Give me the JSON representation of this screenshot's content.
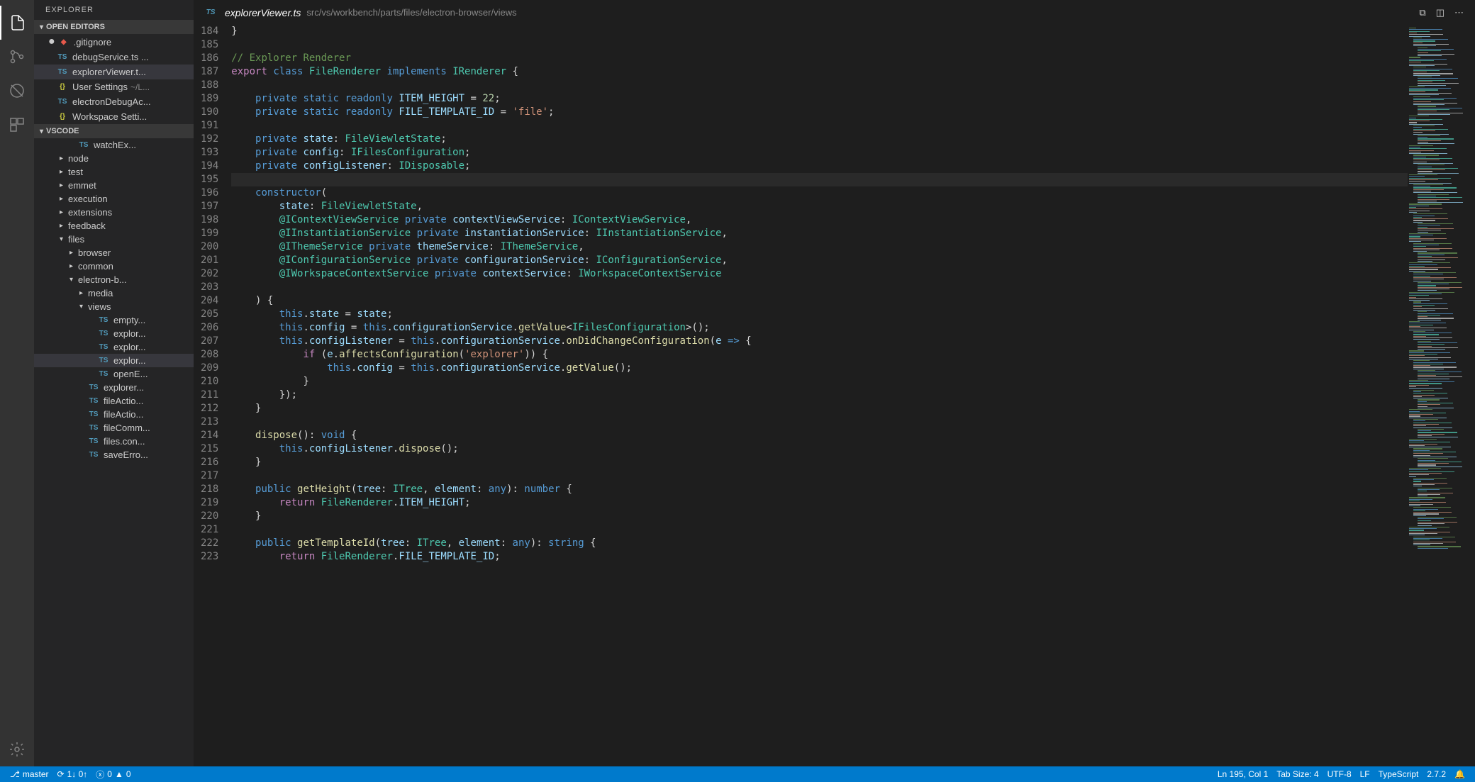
{
  "sidebar": {
    "title": "EXPLORER",
    "openEditorsLabel": "OPEN EDITORS",
    "workspaceLabel": "VSCODE",
    "openEditors": [
      {
        "icon": "git",
        "iconText": "◆",
        "name": ".gitignore",
        "dirty": true,
        "active": false
      },
      {
        "icon": "ts",
        "iconText": "TS",
        "name": "debugService.ts ...",
        "dirty": false,
        "active": false
      },
      {
        "icon": "ts",
        "iconText": "TS",
        "name": "explorerViewer.t...",
        "dirty": false,
        "active": true
      },
      {
        "icon": "json",
        "iconText": "{}",
        "name": "User Settings",
        "meta": "~/L...",
        "dirty": false,
        "active": false
      },
      {
        "icon": "ts",
        "iconText": "TS",
        "name": "electronDebugAc...",
        "dirty": false,
        "active": false
      },
      {
        "icon": "json",
        "iconText": "{}",
        "name": "Workspace Setti...",
        "dirty": false,
        "active": false
      }
    ],
    "tree": [
      {
        "depth": 3,
        "icon": "ts",
        "iconText": "TS",
        "chev": "",
        "name": "watchEx...",
        "selected": false
      },
      {
        "depth": 2,
        "icon": "",
        "iconText": "",
        "chev": "▸",
        "name": "node",
        "selected": false
      },
      {
        "depth": 2,
        "icon": "",
        "iconText": "",
        "chev": "▸",
        "name": "test",
        "selected": false
      },
      {
        "depth": 2,
        "icon": "",
        "iconText": "",
        "chev": "▸",
        "name": "emmet",
        "selected": false
      },
      {
        "depth": 2,
        "icon": "",
        "iconText": "",
        "chev": "▸",
        "name": "execution",
        "selected": false
      },
      {
        "depth": 2,
        "icon": "",
        "iconText": "",
        "chev": "▸",
        "name": "extensions",
        "selected": false
      },
      {
        "depth": 2,
        "icon": "",
        "iconText": "",
        "chev": "▸",
        "name": "feedback",
        "selected": false
      },
      {
        "depth": 2,
        "icon": "",
        "iconText": "",
        "chev": "▾",
        "name": "files",
        "selected": false
      },
      {
        "depth": 3,
        "icon": "",
        "iconText": "",
        "chev": "▸",
        "name": "browser",
        "selected": false
      },
      {
        "depth": 3,
        "icon": "",
        "iconText": "",
        "chev": "▸",
        "name": "common",
        "selected": false
      },
      {
        "depth": 3,
        "icon": "",
        "iconText": "",
        "chev": "▾",
        "name": "electron-b...",
        "selected": false
      },
      {
        "depth": 4,
        "icon": "",
        "iconText": "",
        "chev": "▸",
        "name": "media",
        "selected": false
      },
      {
        "depth": 4,
        "icon": "",
        "iconText": "",
        "chev": "▾",
        "name": "views",
        "selected": false
      },
      {
        "depth": 5,
        "icon": "ts",
        "iconText": "TS",
        "chev": "",
        "name": "empty...",
        "selected": false
      },
      {
        "depth": 5,
        "icon": "ts",
        "iconText": "TS",
        "chev": "",
        "name": "explor...",
        "selected": false
      },
      {
        "depth": 5,
        "icon": "ts",
        "iconText": "TS",
        "chev": "",
        "name": "explor...",
        "selected": false
      },
      {
        "depth": 5,
        "icon": "ts",
        "iconText": "TS",
        "chev": "",
        "name": "explor...",
        "selected": true
      },
      {
        "depth": 5,
        "icon": "ts",
        "iconText": "TS",
        "chev": "",
        "name": "openE...",
        "selected": false
      },
      {
        "depth": 4,
        "icon": "ts",
        "iconText": "TS",
        "chev": "",
        "name": "explorer...",
        "selected": false
      },
      {
        "depth": 4,
        "icon": "ts",
        "iconText": "TS",
        "chev": "",
        "name": "fileActio...",
        "selected": false
      },
      {
        "depth": 4,
        "icon": "ts",
        "iconText": "TS",
        "chev": "",
        "name": "fileActio...",
        "selected": false
      },
      {
        "depth": 4,
        "icon": "ts",
        "iconText": "TS",
        "chev": "",
        "name": "fileComm...",
        "selected": false
      },
      {
        "depth": 4,
        "icon": "ts",
        "iconText": "TS",
        "chev": "",
        "name": "files.con...",
        "selected": false
      },
      {
        "depth": 4,
        "icon": "ts",
        "iconText": "TS",
        "chev": "",
        "name": "saveErro...",
        "selected": false
      }
    ]
  },
  "editor": {
    "fileIcon": "TS",
    "filename": "explorerViewer.ts",
    "path": "src/vs/workbench/parts/files/electron-browser/views",
    "startLine": 184,
    "currentLine": 195,
    "lines": [
      {
        "n": 184,
        "t": "}",
        "indent": 0
      },
      {
        "n": 185,
        "t": "",
        "indent": 0
      },
      {
        "n": 186,
        "t": "// Explorer Renderer",
        "indent": 0,
        "c": "cmt"
      },
      {
        "n": 187,
        "seg": [
          {
            "t": "export ",
            "c": "kw"
          },
          {
            "t": "class ",
            "c": "st"
          },
          {
            "t": "FileRenderer ",
            "c": "cls"
          },
          {
            "t": "implements ",
            "c": "st"
          },
          {
            "t": "IRenderer",
            "c": "cls"
          },
          {
            "t": " {"
          }
        ]
      },
      {
        "n": 188,
        "t": ""
      },
      {
        "n": 189,
        "seg": [
          {
            "t": "    "
          },
          {
            "t": "private static readonly ",
            "c": "st"
          },
          {
            "t": "ITEM_HEIGHT",
            "c": "prop"
          },
          {
            "t": " = "
          },
          {
            "t": "22",
            "c": "num"
          },
          {
            "t": ";"
          }
        ]
      },
      {
        "n": 190,
        "seg": [
          {
            "t": "    "
          },
          {
            "t": "private static readonly ",
            "c": "st"
          },
          {
            "t": "FILE_TEMPLATE_ID",
            "c": "prop"
          },
          {
            "t": " = "
          },
          {
            "t": "'file'",
            "c": "str"
          },
          {
            "t": ";"
          }
        ]
      },
      {
        "n": 191,
        "t": ""
      },
      {
        "n": 192,
        "seg": [
          {
            "t": "    "
          },
          {
            "t": "private ",
            "c": "st"
          },
          {
            "t": "state",
            "c": "prop"
          },
          {
            "t": ": "
          },
          {
            "t": "FileViewletState",
            "c": "cls"
          },
          {
            "t": ";"
          }
        ]
      },
      {
        "n": 193,
        "seg": [
          {
            "t": "    "
          },
          {
            "t": "private ",
            "c": "st"
          },
          {
            "t": "config",
            "c": "prop"
          },
          {
            "t": ": "
          },
          {
            "t": "IFilesConfiguration",
            "c": "cls"
          },
          {
            "t": ";"
          }
        ]
      },
      {
        "n": 194,
        "seg": [
          {
            "t": "    "
          },
          {
            "t": "private ",
            "c": "st"
          },
          {
            "t": "configListener",
            "c": "prop"
          },
          {
            "t": ": "
          },
          {
            "t": "IDisposable",
            "c": "cls"
          },
          {
            "t": ";"
          }
        ]
      },
      {
        "n": 195,
        "t": "",
        "cur": true
      },
      {
        "n": 196,
        "seg": [
          {
            "t": "    "
          },
          {
            "t": "constructor",
            "c": "st"
          },
          {
            "t": "("
          }
        ]
      },
      {
        "n": 197,
        "seg": [
          {
            "t": "        "
          },
          {
            "t": "state",
            "c": "prop"
          },
          {
            "t": ": "
          },
          {
            "t": "FileViewletState",
            "c": "cls"
          },
          {
            "t": ","
          }
        ]
      },
      {
        "n": 198,
        "seg": [
          {
            "t": "        "
          },
          {
            "t": "@IContextViewService ",
            "c": "dec"
          },
          {
            "t": "private ",
            "c": "st"
          },
          {
            "t": "contextViewService",
            "c": "prop"
          },
          {
            "t": ": "
          },
          {
            "t": "IContextViewService",
            "c": "cls"
          },
          {
            "t": ","
          }
        ]
      },
      {
        "n": 199,
        "seg": [
          {
            "t": "        "
          },
          {
            "t": "@IInstantiationService ",
            "c": "dec"
          },
          {
            "t": "private ",
            "c": "st"
          },
          {
            "t": "instantiationService",
            "c": "prop"
          },
          {
            "t": ": "
          },
          {
            "t": "IInstantiationService",
            "c": "cls"
          },
          {
            "t": ","
          }
        ]
      },
      {
        "n": 200,
        "seg": [
          {
            "t": "        "
          },
          {
            "t": "@IThemeService ",
            "c": "dec"
          },
          {
            "t": "private ",
            "c": "st"
          },
          {
            "t": "themeService",
            "c": "prop"
          },
          {
            "t": ": "
          },
          {
            "t": "IThemeService",
            "c": "cls"
          },
          {
            "t": ","
          }
        ]
      },
      {
        "n": 201,
        "seg": [
          {
            "t": "        "
          },
          {
            "t": "@IConfigurationService ",
            "c": "dec"
          },
          {
            "t": "private ",
            "c": "st"
          },
          {
            "t": "configurationService",
            "c": "prop"
          },
          {
            "t": ": "
          },
          {
            "t": "IConfigurationService",
            "c": "cls"
          },
          {
            "t": ","
          }
        ]
      },
      {
        "n": 202,
        "seg": [
          {
            "t": "        "
          },
          {
            "t": "@IWorkspaceContextService ",
            "c": "dec"
          },
          {
            "t": "private ",
            "c": "st"
          },
          {
            "t": "contextService",
            "c": "prop"
          },
          {
            "t": ": "
          },
          {
            "t": "IWorkspaceContextService",
            "c": "cls"
          }
        ]
      },
      {
        "n": 203,
        "t": ""
      },
      {
        "n": 204,
        "t": "    ) {"
      },
      {
        "n": 205,
        "seg": [
          {
            "t": "        "
          },
          {
            "t": "this",
            "c": "st"
          },
          {
            "t": "."
          },
          {
            "t": "state",
            "c": "prop"
          },
          {
            "t": " = "
          },
          {
            "t": "state",
            "c": "prop"
          },
          {
            "t": ";"
          }
        ]
      },
      {
        "n": 206,
        "seg": [
          {
            "t": "        "
          },
          {
            "t": "this",
            "c": "st"
          },
          {
            "t": "."
          },
          {
            "t": "config",
            "c": "prop"
          },
          {
            "t": " = "
          },
          {
            "t": "this",
            "c": "st"
          },
          {
            "t": "."
          },
          {
            "t": "configurationService",
            "c": "prop"
          },
          {
            "t": "."
          },
          {
            "t": "getValue",
            "c": "fn"
          },
          {
            "t": "<"
          },
          {
            "t": "IFilesConfiguration",
            "c": "cls"
          },
          {
            "t": ">();"
          }
        ]
      },
      {
        "n": 207,
        "seg": [
          {
            "t": "        "
          },
          {
            "t": "this",
            "c": "st"
          },
          {
            "t": "."
          },
          {
            "t": "configListener",
            "c": "prop"
          },
          {
            "t": " = "
          },
          {
            "t": "this",
            "c": "st"
          },
          {
            "t": "."
          },
          {
            "t": "configurationService",
            "c": "prop"
          },
          {
            "t": "."
          },
          {
            "t": "onDidChangeConfiguration",
            "c": "fn"
          },
          {
            "t": "("
          },
          {
            "t": "e",
            "c": "prop"
          },
          {
            "t": " "
          },
          {
            "t": "=>",
            "c": "st"
          },
          {
            "t": " {"
          }
        ]
      },
      {
        "n": 208,
        "seg": [
          {
            "t": "            "
          },
          {
            "t": "if ",
            "c": "kw"
          },
          {
            "t": "("
          },
          {
            "t": "e",
            "c": "prop"
          },
          {
            "t": "."
          },
          {
            "t": "affectsConfiguration",
            "c": "fn"
          },
          {
            "t": "("
          },
          {
            "t": "'explorer'",
            "c": "str"
          },
          {
            "t": ")) {"
          }
        ]
      },
      {
        "n": 209,
        "seg": [
          {
            "t": "                "
          },
          {
            "t": "this",
            "c": "st"
          },
          {
            "t": "."
          },
          {
            "t": "config",
            "c": "prop"
          },
          {
            "t": " = "
          },
          {
            "t": "this",
            "c": "st"
          },
          {
            "t": "."
          },
          {
            "t": "configurationService",
            "c": "prop"
          },
          {
            "t": "."
          },
          {
            "t": "getValue",
            "c": "fn"
          },
          {
            "t": "();"
          }
        ]
      },
      {
        "n": 210,
        "t": "            }"
      },
      {
        "n": 211,
        "t": "        });"
      },
      {
        "n": 212,
        "t": "    }"
      },
      {
        "n": 213,
        "t": ""
      },
      {
        "n": 214,
        "seg": [
          {
            "t": "    "
          },
          {
            "t": "dispose",
            "c": "fn"
          },
          {
            "t": "(): "
          },
          {
            "t": "void",
            "c": "st"
          },
          {
            "t": " {"
          }
        ]
      },
      {
        "n": 215,
        "seg": [
          {
            "t": "        "
          },
          {
            "t": "this",
            "c": "st"
          },
          {
            "t": "."
          },
          {
            "t": "configListener",
            "c": "prop"
          },
          {
            "t": "."
          },
          {
            "t": "dispose",
            "c": "fn"
          },
          {
            "t": "();"
          }
        ]
      },
      {
        "n": 216,
        "t": "    }"
      },
      {
        "n": 217,
        "t": ""
      },
      {
        "n": 218,
        "seg": [
          {
            "t": "    "
          },
          {
            "t": "public ",
            "c": "st"
          },
          {
            "t": "getHeight",
            "c": "fn"
          },
          {
            "t": "("
          },
          {
            "t": "tree",
            "c": "prop"
          },
          {
            "t": ": "
          },
          {
            "t": "ITree",
            "c": "cls"
          },
          {
            "t": ", "
          },
          {
            "t": "element",
            "c": "prop"
          },
          {
            "t": ": "
          },
          {
            "t": "any",
            "c": "st"
          },
          {
            "t": "): "
          },
          {
            "t": "number",
            "c": "st"
          },
          {
            "t": " {"
          }
        ]
      },
      {
        "n": 219,
        "seg": [
          {
            "t": "        "
          },
          {
            "t": "return ",
            "c": "kw"
          },
          {
            "t": "FileRenderer",
            "c": "cls"
          },
          {
            "t": "."
          },
          {
            "t": "ITEM_HEIGHT",
            "c": "prop"
          },
          {
            "t": ";"
          }
        ]
      },
      {
        "n": 220,
        "t": "    }"
      },
      {
        "n": 221,
        "t": ""
      },
      {
        "n": 222,
        "seg": [
          {
            "t": "    "
          },
          {
            "t": "public ",
            "c": "st"
          },
          {
            "t": "getTemplateId",
            "c": "fn"
          },
          {
            "t": "("
          },
          {
            "t": "tree",
            "c": "prop"
          },
          {
            "t": ": "
          },
          {
            "t": "ITree",
            "c": "cls"
          },
          {
            "t": ", "
          },
          {
            "t": "element",
            "c": "prop"
          },
          {
            "t": ": "
          },
          {
            "t": "any",
            "c": "st"
          },
          {
            "t": "): "
          },
          {
            "t": "string",
            "c": "st"
          },
          {
            "t": " {"
          }
        ]
      },
      {
        "n": 223,
        "seg": [
          {
            "t": "        "
          },
          {
            "t": "return ",
            "c": "kw"
          },
          {
            "t": "FileRenderer",
            "c": "cls"
          },
          {
            "t": "."
          },
          {
            "t": "FILE_TEMPLATE_ID",
            "c": "prop"
          },
          {
            "t": ";"
          }
        ]
      }
    ]
  },
  "status": {
    "branch": "master",
    "sync": "1↓ 0↑",
    "errors": "0",
    "warnings": "0",
    "lineCol": "Ln 195, Col 1",
    "tabSize": "Tab Size: 4",
    "encoding": "UTF-8",
    "eol": "LF",
    "language": "TypeScript",
    "version": "2.7.2"
  }
}
